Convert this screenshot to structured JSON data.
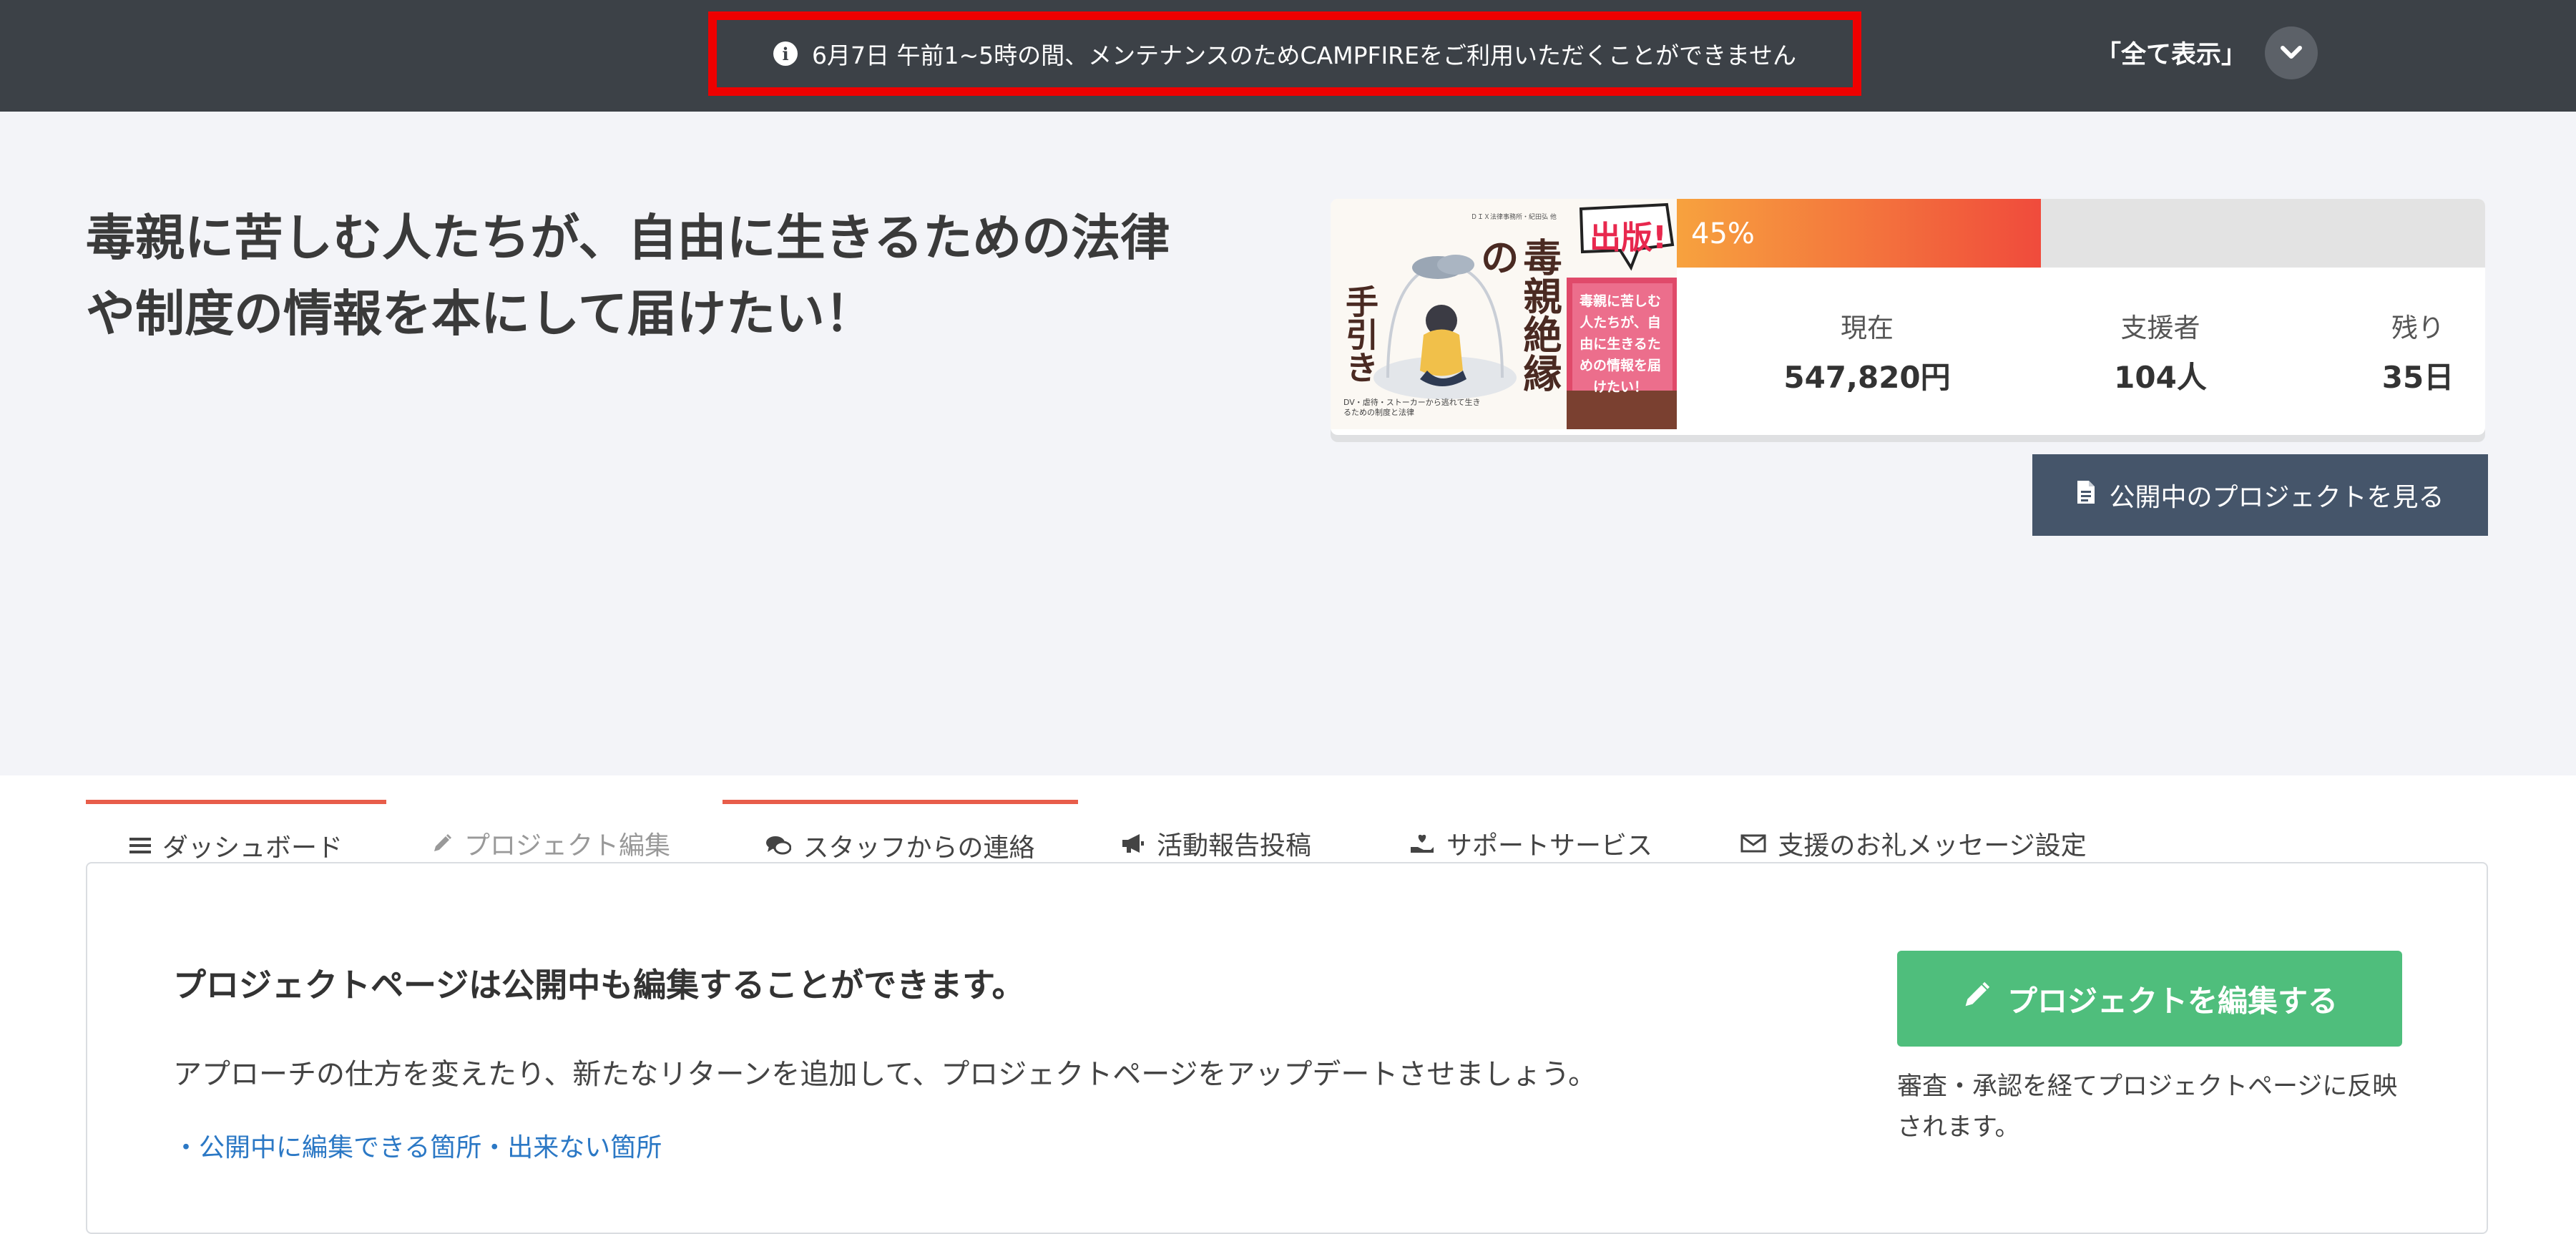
{
  "topbar": {
    "notice_text": "6月7日 午前1~5時の間、メンテナンスのためCAMPFIREをご利用いただくことができません",
    "show_all_label": "「全て表示」"
  },
  "project": {
    "title_line1": "毒親に苦しむ人たちが、自由に生きるための法律",
    "title_line2": "や制度の情報を本にして届けたい！"
  },
  "cover": {
    "headline": "毒親絶縁の",
    "subhead": "手引き",
    "badge": "出版!",
    "band_text": "毒親に苦しむ人たちが、自由に生きるための情報を届けたい！",
    "authors": "ＤＩＸ法律事務所・紀田弘 他",
    "caption": "DV・虐待・ストーカーから逃れて生きるための制度と法律"
  },
  "stats": {
    "progress_label": "45%",
    "progress_fraction": 0.45,
    "current_label": "現在",
    "current_value": "547,820円",
    "backers_label": "支援者",
    "backers_value": "104人",
    "remaining_label": "残り",
    "remaining_value": "35日"
  },
  "view_button": "公開中のプロジェクトを見る",
  "tabs": [
    {
      "label": "ダッシュボード",
      "icon": "list-icon"
    },
    {
      "label": "プロジェクト編集",
      "icon": "pencil-icon"
    },
    {
      "label": "スタッフからの連絡",
      "icon": "comments-icon"
    },
    {
      "label": "活動報告投稿",
      "icon": "megaphone-icon"
    },
    {
      "label": "サポートサービス",
      "icon": "hand-heart-icon"
    },
    {
      "label": "支援のお礼メッセージ設定",
      "icon": "envelope-icon"
    }
  ],
  "main": {
    "heading": "プロジェクトページは公開中も編集することができます。",
    "description": "アプローチの仕方を変えたり、新たなリターンを追加して、プロジェクトページをアップデートさせましょう。",
    "link": "・公開中に編集できる箇所・出来ない箇所",
    "edit_button": "プロジェクトを編集する",
    "edit_note": "審査・承認を経てプロジェクトページに反映されます。"
  },
  "colors": {
    "topbar": "#3c4147",
    "notice_border": "#ee0000",
    "header_bg": "#f3f4f8",
    "progress_start": "#f7a23e",
    "progress_end": "#f04b3c",
    "view_button": "#45556a",
    "tab_accent": "#e85d4a",
    "edit_button": "#4fbe7c",
    "link": "#2b78c5"
  }
}
